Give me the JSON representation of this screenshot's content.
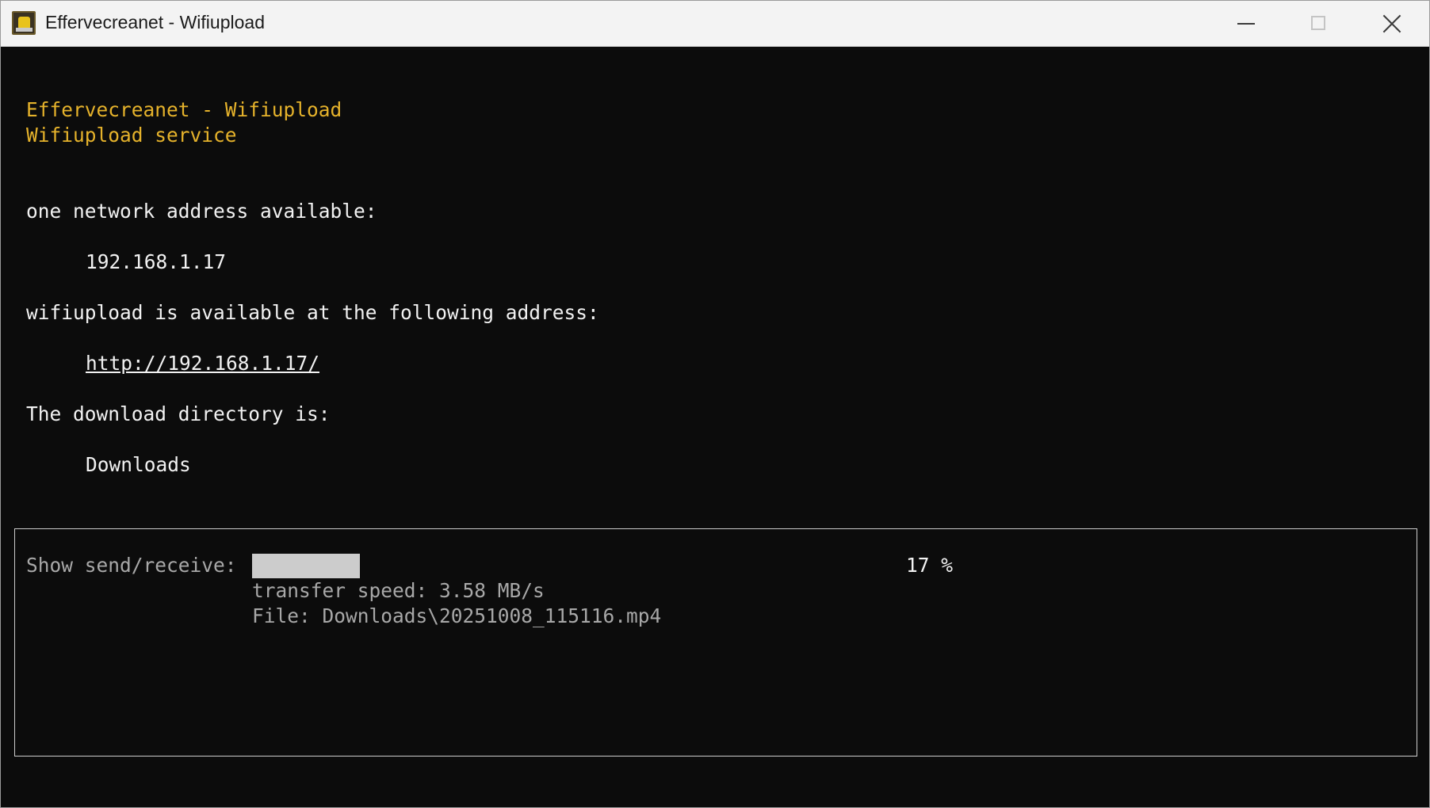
{
  "window": {
    "title": "Effervecreanet - Wifiupload",
    "icon": "app-icon",
    "controls": {
      "minimize": "minimize-icon",
      "maximize": "maximize-icon",
      "close": "close-icon"
    }
  },
  "console": {
    "header_line1": "Effervecreanet - Wifiupload",
    "header_line2": "Wifiupload service",
    "network_label": "one network address available:",
    "ip_address": "192.168.1.17",
    "address_label": "wifiupload is available at the following address:",
    "url": "http://192.168.1.17/",
    "directory_label": "The download directory is:",
    "directory": "Downloads"
  },
  "status": {
    "show_label": "Show send/receive:",
    "progress_percent": 17,
    "percent_text": "17 %",
    "speed_text": "transfer speed: 3.58 MB/s",
    "file_text": "File: Downloads\\20251008_115116.mp4"
  },
  "colors": {
    "background": "#0c0c0c",
    "header_yellow": "#e5b22b",
    "text": "#f2f2f2",
    "status_gray": "#a8a8a8",
    "progress_fill": "#cccccc"
  }
}
